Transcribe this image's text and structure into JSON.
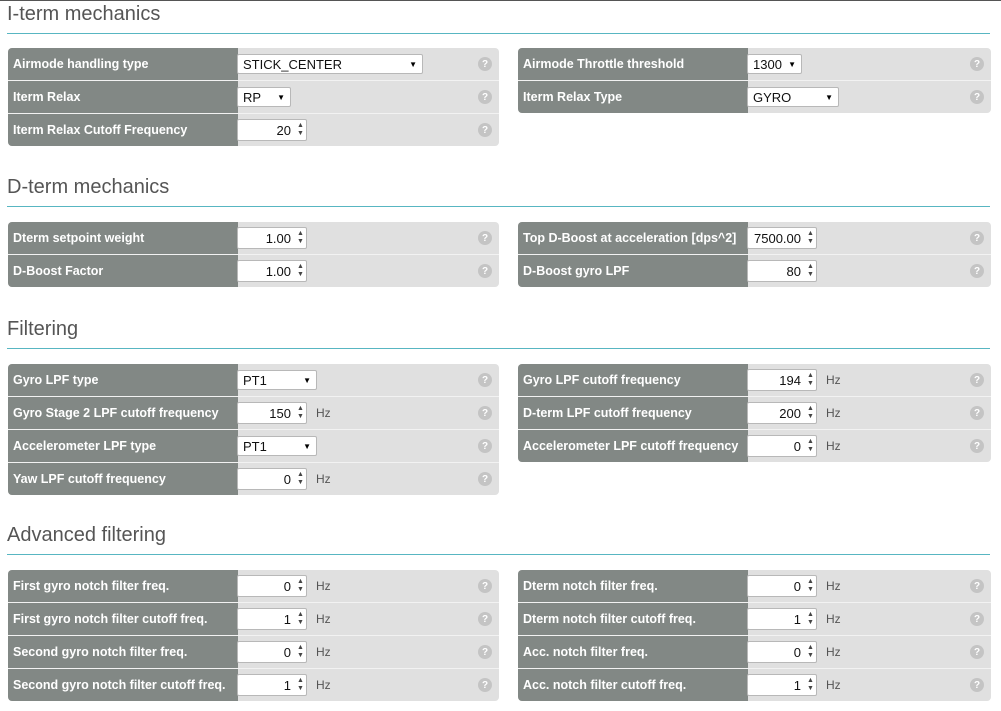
{
  "sections": {
    "iterm": {
      "title": "I-term mechanics",
      "left": [
        {
          "label": "Airmode handling type",
          "type": "select",
          "value": "STICK_CENTER"
        },
        {
          "label": "Iterm Relax",
          "type": "select",
          "value": "RP"
        },
        {
          "label": "Iterm Relax Cutoff Frequency",
          "type": "number",
          "value": "20"
        }
      ],
      "right": [
        {
          "label": "Airmode Throttle threshold",
          "type": "select",
          "value": "1300"
        },
        {
          "label": "Iterm Relax Type",
          "type": "select",
          "value": "GYRO"
        }
      ]
    },
    "dterm": {
      "title": "D-term mechanics",
      "left": [
        {
          "label": "Dterm setpoint weight",
          "type": "number",
          "value": "1.00"
        },
        {
          "label": "D-Boost Factor",
          "type": "number",
          "value": "1.00"
        }
      ],
      "right": [
        {
          "label": "Top D-Boost at acceleration [dps^2]",
          "type": "number",
          "value": "7500.00"
        },
        {
          "label": "D-Boost gyro LPF",
          "type": "number",
          "value": "80"
        }
      ]
    },
    "filtering": {
      "title": "Filtering",
      "left": [
        {
          "label": "Gyro LPF type",
          "type": "select",
          "value": "PT1"
        },
        {
          "label": "Gyro Stage 2 LPF cutoff frequency",
          "type": "number",
          "value": "150",
          "unit": "Hz"
        },
        {
          "label": "Accelerometer LPF type",
          "type": "select",
          "value": "PT1"
        },
        {
          "label": "Yaw LPF cutoff frequency",
          "type": "number",
          "value": "0",
          "unit": "Hz"
        }
      ],
      "right": [
        {
          "label": "Gyro LPF cutoff frequency",
          "type": "number",
          "value": "194",
          "unit": "Hz"
        },
        {
          "label": "D-term LPF cutoff frequency",
          "type": "number",
          "value": "200",
          "unit": "Hz"
        },
        {
          "label": "Accelerometer LPF cutoff frequency",
          "type": "number",
          "value": "0",
          "unit": "Hz"
        }
      ]
    },
    "advanced": {
      "title": "Advanced filtering",
      "left": [
        {
          "label": "First gyro notch filter freq.",
          "type": "number",
          "value": "0",
          "unit": "Hz"
        },
        {
          "label": "First gyro notch filter cutoff freq.",
          "type": "number",
          "value": "1",
          "unit": "Hz"
        },
        {
          "label": "Second gyro notch filter freq.",
          "type": "number",
          "value": "0",
          "unit": "Hz"
        },
        {
          "label": "Second gyro notch filter cutoff freq.",
          "type": "number",
          "value": "1",
          "unit": "Hz"
        }
      ],
      "right": [
        {
          "label": "Dterm notch filter freq.",
          "type": "number",
          "value": "0",
          "unit": "Hz"
        },
        {
          "label": "Dterm notch filter cutoff freq.",
          "type": "number",
          "value": "1",
          "unit": "Hz"
        },
        {
          "label": "Acc. notch filter freq.",
          "type": "number",
          "value": "0",
          "unit": "Hz"
        },
        {
          "label": "Acc. notch filter cutoff freq.",
          "type": "number",
          "value": "1",
          "unit": "Hz"
        }
      ]
    }
  },
  "icons": {
    "help": "help-question-icon",
    "dropdown": "dropdown-arrow-icon",
    "spinner": "spinner-arrows-icon"
  },
  "colors": {
    "label_bg": "#828885",
    "panel_bg": "#e0e0e0",
    "accent_line": "#58b6c2"
  }
}
